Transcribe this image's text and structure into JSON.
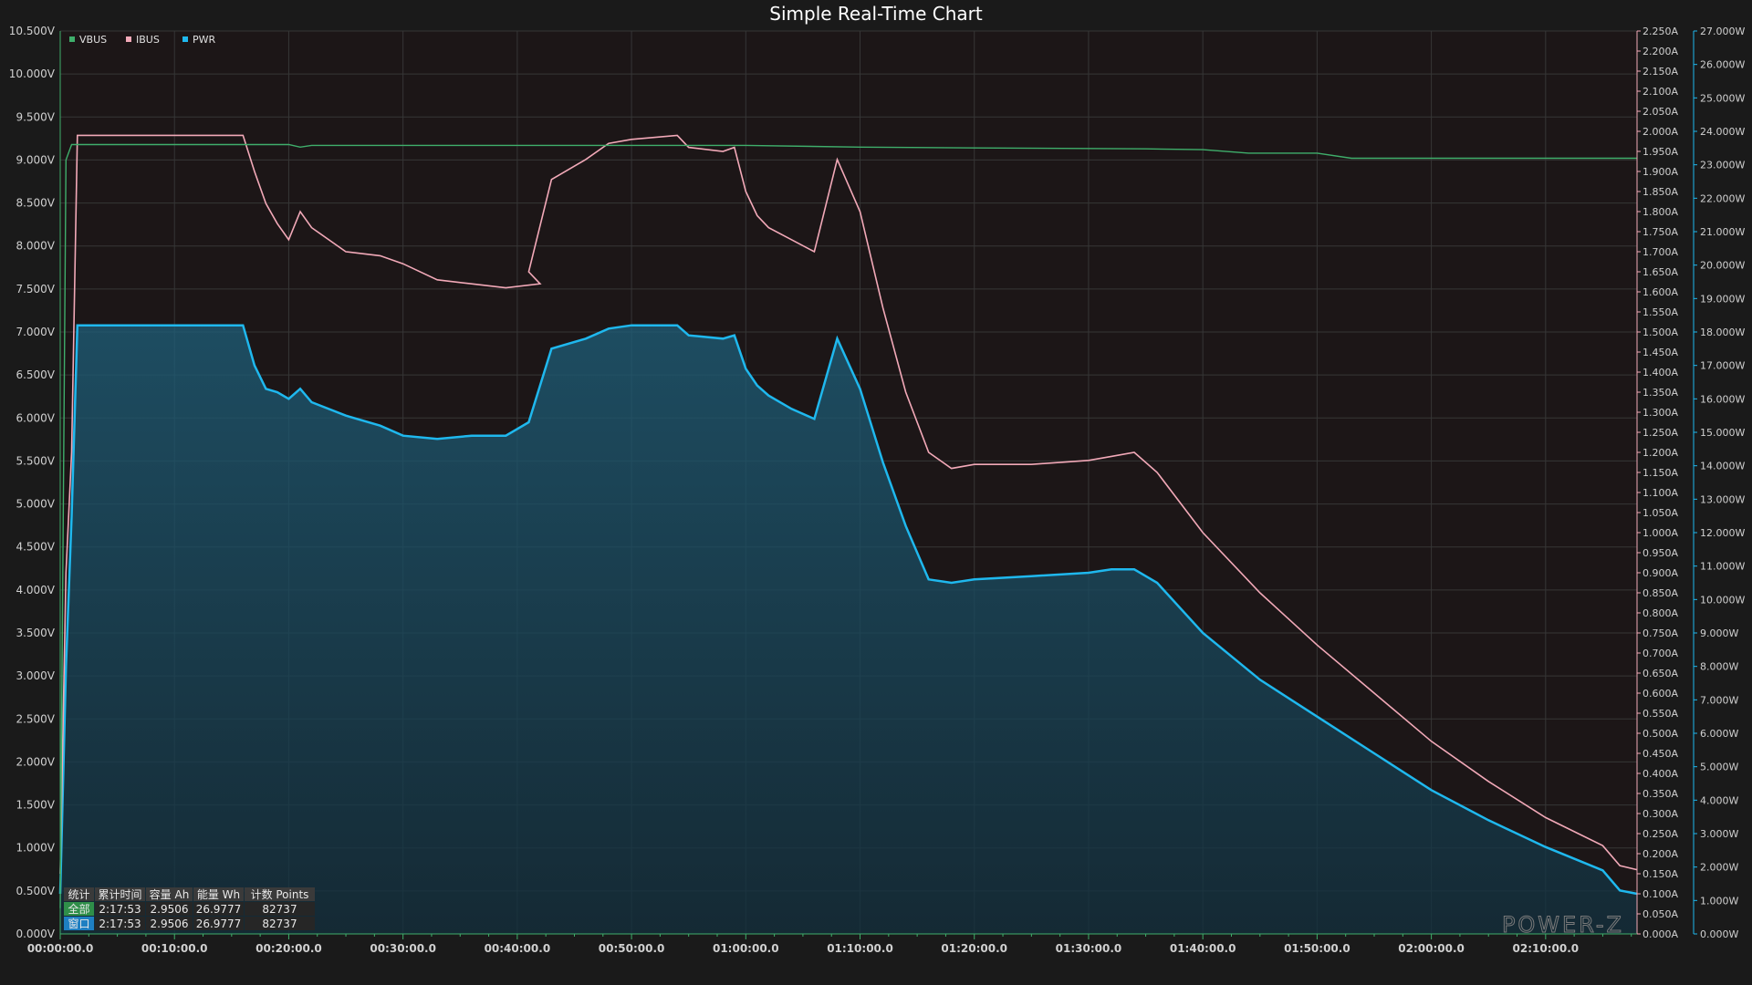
{
  "chart_data": {
    "type": "line",
    "title": "Simple Real-Time Chart",
    "x_ticks": [
      "00:00:00.0",
      "00:10:00.0",
      "00:20:00.0",
      "00:30:00.0",
      "00:40:00.0",
      "00:50:00.0",
      "01:00:00.0",
      "01:10:00.0",
      "01:20:00.0",
      "01:30:00.0",
      "01:40:00.0",
      "01:50:00.0",
      "02:00:00.0",
      "02:10:00.0"
    ],
    "x_range_min": [
      0,
      138
    ],
    "axes": {
      "voltage": {
        "ylim": [
          0,
          10.5
        ],
        "ticks": [
          "0.000V",
          "0.500V",
          "1.000V",
          "1.500V",
          "2.000V",
          "2.500V",
          "3.000V",
          "3.500V",
          "4.000V",
          "4.500V",
          "5.000V",
          "5.500V",
          "6.000V",
          "6.500V",
          "7.000V",
          "7.500V",
          "8.000V",
          "8.500V",
          "9.000V",
          "9.500V",
          "10.000V",
          "10.500V"
        ]
      },
      "current": {
        "ylim": [
          0,
          2.25
        ],
        "ticks": [
          "0.000A",
          "0.050A",
          "0.100A",
          "0.150A",
          "0.200A",
          "0.250A",
          "0.300A",
          "0.350A",
          "0.400A",
          "0.450A",
          "0.500A",
          "0.550A",
          "0.600A",
          "0.650A",
          "0.700A",
          "0.750A",
          "0.800A",
          "0.850A",
          "0.900A",
          "0.950A",
          "1.000A",
          "1.050A",
          "1.100A",
          "1.150A",
          "1.200A",
          "1.250A",
          "1.300A",
          "1.350A",
          "1.400A",
          "1.450A",
          "1.500A",
          "1.550A",
          "1.600A",
          "1.650A",
          "1.700A",
          "1.750A",
          "1.800A",
          "1.850A",
          "1.900A",
          "1.950A",
          "2.000A",
          "2.050A",
          "2.100A",
          "2.150A",
          "2.200A",
          "2.250A"
        ]
      },
      "power": {
        "ylim": [
          0,
          27
        ],
        "ticks": [
          "0.000W",
          "1.000W",
          "2.000W",
          "3.000W",
          "4.000W",
          "5.000W",
          "6.000W",
          "7.000W",
          "8.000W",
          "9.000W",
          "10.000W",
          "11.000W",
          "12.000W",
          "13.000W",
          "14.000W",
          "15.000W",
          "16.000W",
          "17.000W",
          "18.000W",
          "19.000W",
          "20.000W",
          "21.000W",
          "22.000W",
          "23.000W",
          "24.000W",
          "25.000W",
          "26.000W",
          "27.000W"
        ]
      }
    },
    "x_unit": "minutes",
    "series": [
      {
        "name": "VBUS",
        "axis": "voltage",
        "color": "#3fae6b",
        "x": [
          0,
          0.5,
          1,
          20,
          21,
          22,
          60,
          70,
          80,
          95,
          100,
          104,
          110,
          113,
          120,
          138
        ],
        "values": [
          0.3,
          9.0,
          9.18,
          9.18,
          9.15,
          9.17,
          9.17,
          9.15,
          9.14,
          9.13,
          9.12,
          9.08,
          9.08,
          9.02,
          9.02,
          9.02
        ]
      },
      {
        "name": "IBUS",
        "axis": "current",
        "color": "#f2a9b8",
        "x": [
          0,
          0.5,
          1,
          1.5,
          16,
          17,
          18,
          19,
          20,
          21,
          22,
          25,
          28,
          30,
          33,
          36,
          39,
          42,
          41,
          43,
          46,
          48,
          50,
          54,
          55,
          58,
          59,
          60,
          61,
          62,
          64,
          66,
          68,
          70,
          72,
          74,
          76,
          78,
          80,
          85,
          90,
          92,
          94,
          96,
          100,
          105,
          110,
          115,
          120,
          125,
          130,
          135,
          136.5,
          138
        ],
        "values": [
          0.15,
          0.9,
          1.2,
          1.99,
          1.99,
          1.9,
          1.82,
          1.77,
          1.73,
          1.8,
          1.76,
          1.7,
          1.69,
          1.67,
          1.63,
          1.62,
          1.61,
          1.62,
          1.65,
          1.88,
          1.93,
          1.97,
          1.98,
          1.99,
          1.96,
          1.95,
          1.96,
          1.85,
          1.79,
          1.76,
          1.73,
          1.7,
          1.93,
          1.8,
          1.56,
          1.35,
          1.2,
          1.16,
          1.17,
          1.17,
          1.18,
          1.19,
          1.2,
          1.15,
          1.0,
          0.85,
          0.72,
          0.6,
          0.48,
          0.38,
          0.29,
          0.22,
          0.17,
          0.16
        ]
      },
      {
        "name": "PWR",
        "axis": "power",
        "color": "#1fb8ee",
        "x": [
          0,
          0.5,
          1,
          1.5,
          16,
          17,
          18,
          19,
          20,
          21,
          22,
          25,
          28,
          30,
          33,
          36,
          39,
          41,
          43,
          46,
          48,
          50,
          54,
          55,
          58,
          59,
          60,
          61,
          62,
          64,
          66,
          68,
          70,
          72,
          74,
          76,
          78,
          80,
          85,
          90,
          92,
          94,
          96,
          100,
          105,
          110,
          115,
          120,
          125,
          130,
          135,
          136.5,
          138
        ],
        "values": [
          1.2,
          8.0,
          12.5,
          18.2,
          18.2,
          17.0,
          16.3,
          16.2,
          16.0,
          16.3,
          15.9,
          15.5,
          15.2,
          14.9,
          14.8,
          14.9,
          14.9,
          15.3,
          17.5,
          17.8,
          18.1,
          18.2,
          18.2,
          17.9,
          17.8,
          17.9,
          16.9,
          16.4,
          16.1,
          15.7,
          15.4,
          17.8,
          16.3,
          14.1,
          12.2,
          10.6,
          10.5,
          10.6,
          10.7,
          10.8,
          10.9,
          10.9,
          10.5,
          9.0,
          7.6,
          6.5,
          5.4,
          4.3,
          3.4,
          2.6,
          1.9,
          1.3,
          1.2
        ]
      }
    ],
    "grid": true,
    "legend": "top-left"
  },
  "stats_table": {
    "headers": [
      "统计",
      "累计时间",
      "容量 Ah",
      "能量 Wh",
      "计数 Points"
    ],
    "rows": [
      {
        "label": "全部",
        "time": "2:17:53",
        "ah": "2.9506",
        "wh": "26.9777",
        "points": "82737"
      },
      {
        "label": "窗口",
        "time": "2:17:53",
        "ah": "2.9506",
        "wh": "26.9777",
        "points": "82737"
      }
    ]
  },
  "watermark": "POWER-Z",
  "colors": {
    "background": "#1a1a1a",
    "plot_bg": "#1c1617",
    "grid": "#3a3a3a",
    "vbus": "#3fae6b",
    "ibus": "#f2a9b8",
    "pwr": "#1fb8ee"
  }
}
